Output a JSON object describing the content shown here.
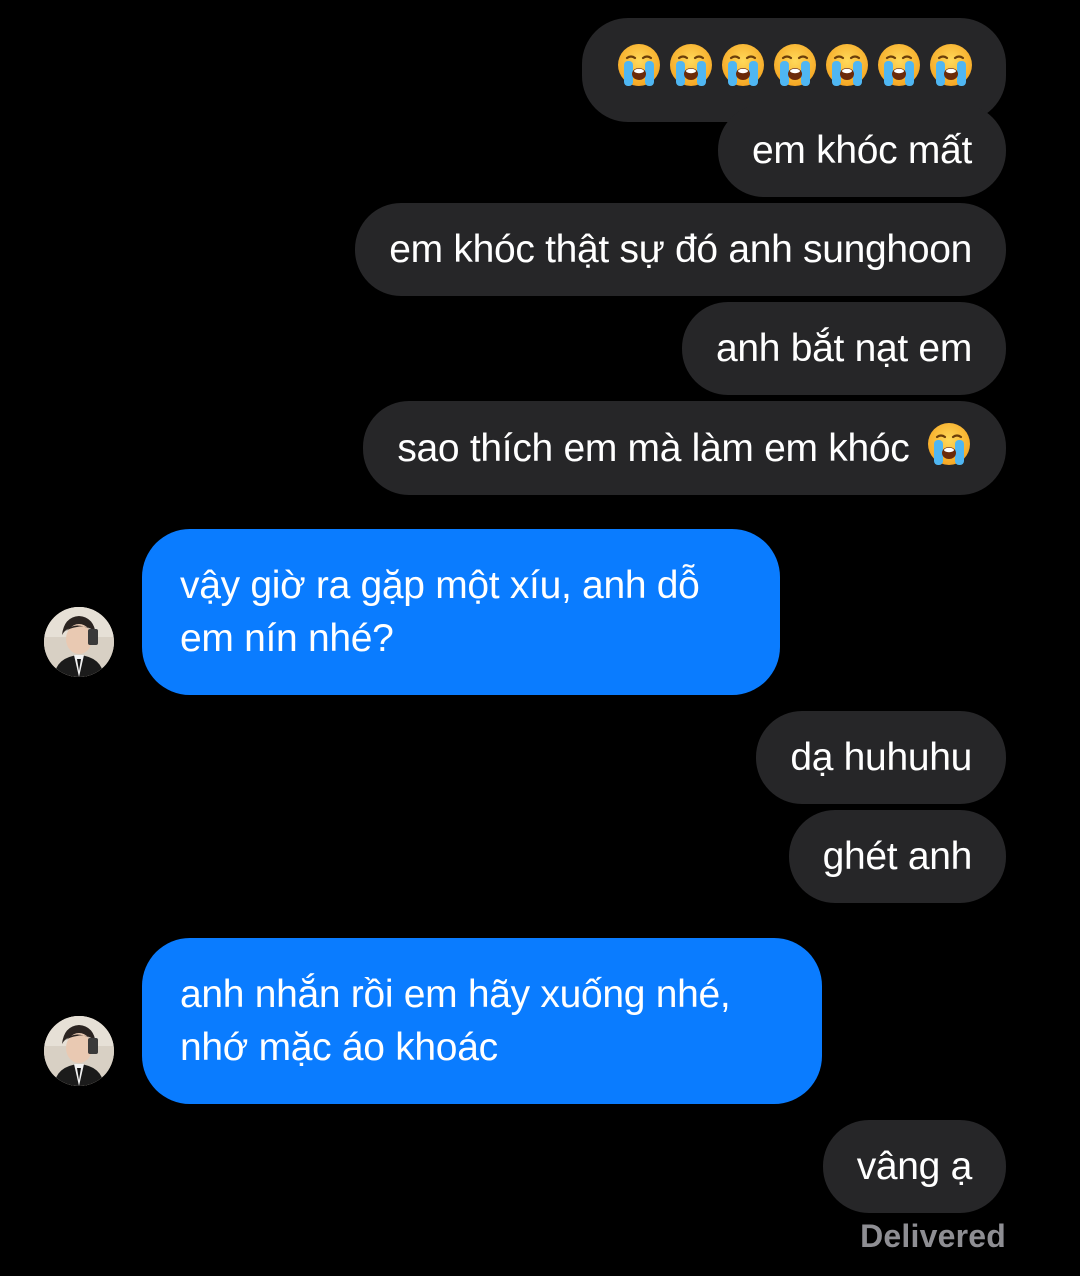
{
  "conversation": {
    "messages": [
      {
        "id": "m1",
        "sender": "me",
        "text": "",
        "emoji_count": 7,
        "emoji": "loudly-crying-face"
      },
      {
        "id": "m2",
        "sender": "me",
        "text": "em khóc mất"
      },
      {
        "id": "m3",
        "sender": "me",
        "text": "em khóc thật sự đó anh sunghoon"
      },
      {
        "id": "m4",
        "sender": "me",
        "text": "anh bắt nạt em"
      },
      {
        "id": "m5",
        "sender": "me",
        "text": "sao thích em mà làm em khóc",
        "emoji": "loudly-crying-face"
      },
      {
        "id": "m6",
        "sender": "them",
        "lines": [
          "vậy giờ ra gặp một xíu, anh dỗ",
          "em nín nhé?"
        ]
      },
      {
        "id": "m7",
        "sender": "me",
        "text": "dạ huhuhu"
      },
      {
        "id": "m8",
        "sender": "me",
        "text": "ghét anh"
      },
      {
        "id": "m9",
        "sender": "them",
        "lines": [
          "anh nhắn rồi em hãy xuống nhé,",
          "nhớ mặc áo khoác"
        ]
      },
      {
        "id": "m10",
        "sender": "me",
        "text": "vâng ạ"
      }
    ],
    "status": "Delivered"
  },
  "theme": {
    "background": "#000000",
    "outgoing_bubble": "#262628",
    "incoming_bubble": "#0a7cff",
    "text": "#ffffff",
    "status_text": "#8e8e93"
  },
  "icons": {
    "cry_emoji": "loudly-crying-face-icon",
    "avatar": "contact-avatar"
  }
}
